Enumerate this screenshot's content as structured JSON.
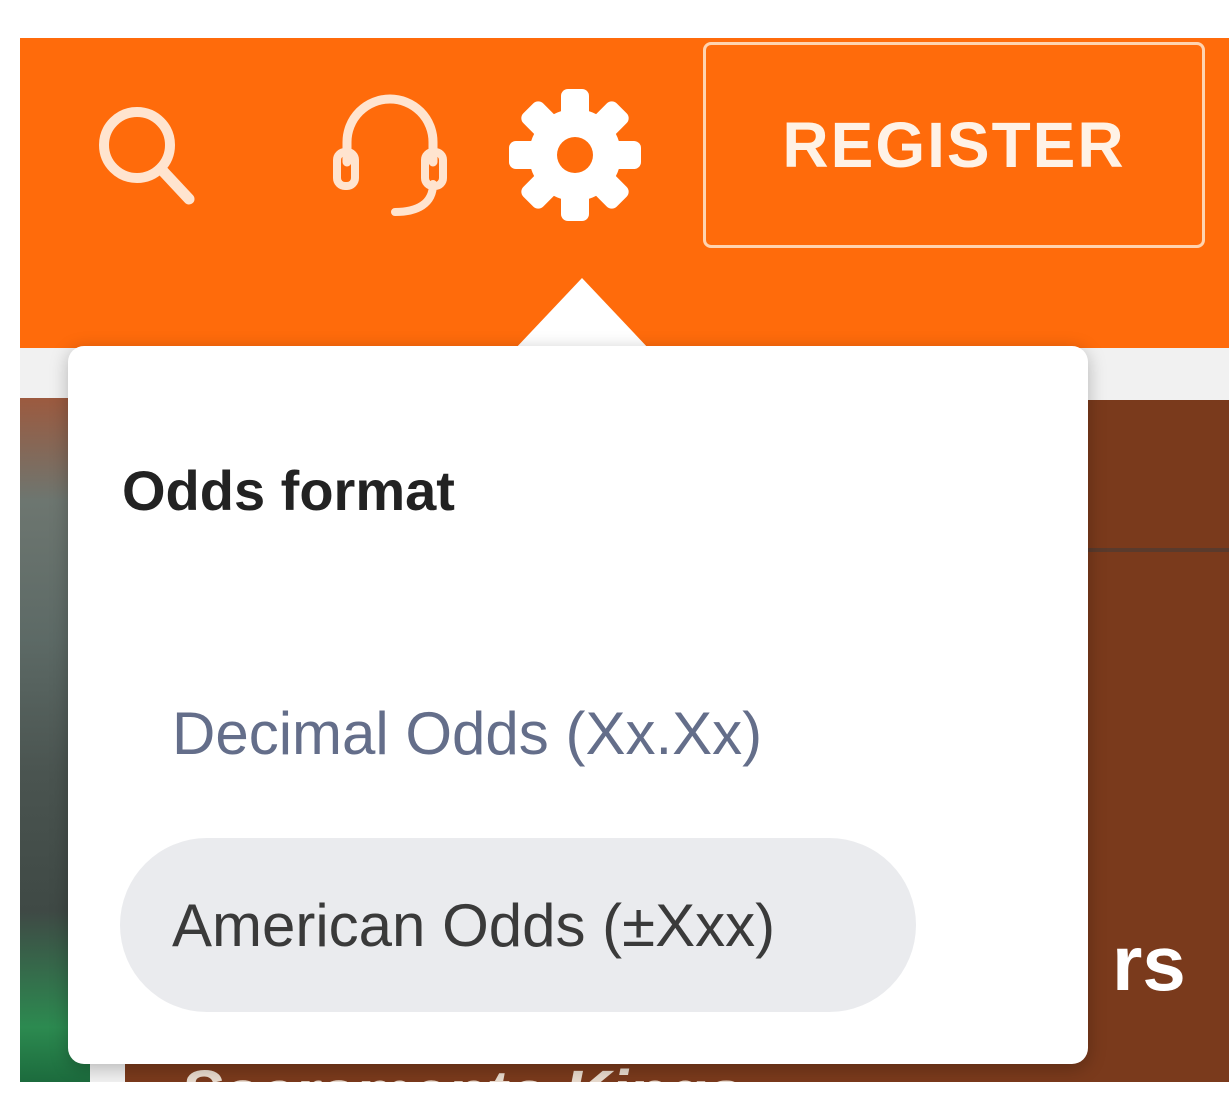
{
  "header": {
    "register_label": "REGISTER",
    "icons": [
      "search-icon",
      "headset-icon",
      "gear-icon"
    ]
  },
  "odds_popover": {
    "title": "Odds format",
    "options": [
      {
        "label": "Decimal Odds (Xx.Xx)",
        "selected": false
      },
      {
        "label": "American Odds (±Xxx)",
        "selected": true
      }
    ]
  },
  "background": {
    "partial_text": "rs",
    "partial_text_bottom": "Sacramento Kings"
  },
  "colors": {
    "brand_orange": "#ff6b0b",
    "selected_bg": "#eaebee",
    "option_text": "#646e8a"
  }
}
